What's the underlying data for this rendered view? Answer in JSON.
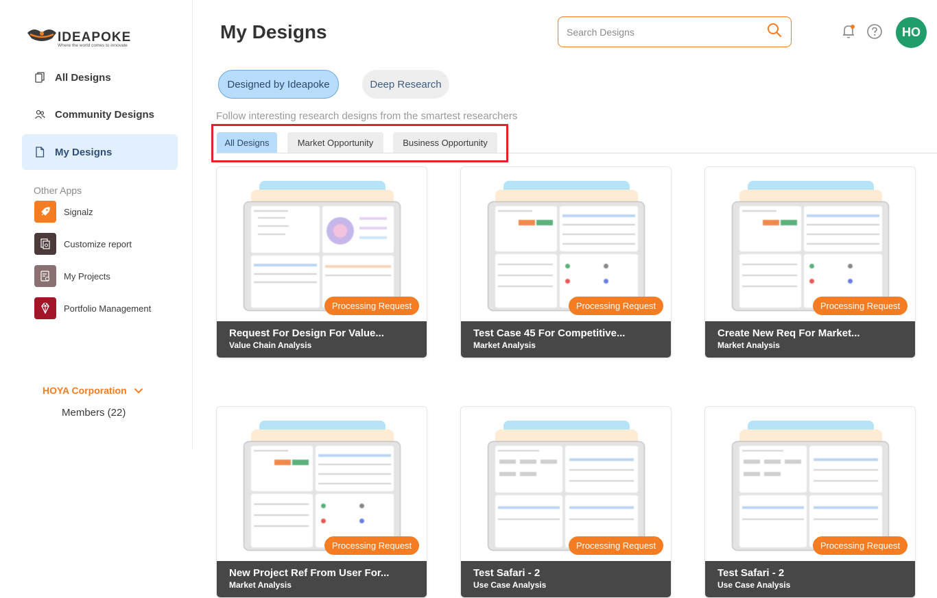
{
  "brand": {
    "name": "IDEAPOKE",
    "tagline": "Where the world comes to innovate"
  },
  "sidebar": {
    "items": [
      {
        "label": "All Designs",
        "icon": "copy-icon",
        "active": false
      },
      {
        "label": "Community Designs",
        "icon": "users-icon",
        "active": false
      },
      {
        "label": "My Designs",
        "icon": "file-icon",
        "active": true
      }
    ],
    "other_apps_title": "Other Apps",
    "apps": [
      {
        "label": "Signalz",
        "icon": "rocket-icon",
        "color": "#f47c22"
      },
      {
        "label": "Customize report",
        "icon": "report-icon",
        "color": "#4a3a3a"
      },
      {
        "label": "My Projects",
        "icon": "projects-icon",
        "color": "#8a7070"
      },
      {
        "label": "Portfolio Management",
        "icon": "gem-icon",
        "color": "#a3162a"
      }
    ],
    "org": {
      "name": "HOYA Corporation",
      "members": "Members (22)"
    }
  },
  "header": {
    "title": "My Designs",
    "search_placeholder": "Search Designs",
    "avatar_initials": "HO"
  },
  "pills": {
    "active": "Designed by Ideapoke",
    "inactive": "Deep Research"
  },
  "subtitle": "Follow interesting research designs from the smartest researchers",
  "tabs": [
    "All Designs",
    "Market Opportunity",
    "Business Opportunity"
  ],
  "badge_label": "Processing Request",
  "cards": [
    {
      "title": "Request For Design For Value...",
      "subtitle": "Value Chain Analysis",
      "thumb": "vca"
    },
    {
      "title": "Test Case 45 For Competitive...",
      "subtitle": "Market Analysis",
      "thumb": "ma"
    },
    {
      "title": "Create New Req For Market...",
      "subtitle": "Market Analysis",
      "thumb": "ma"
    },
    {
      "title": "New Project Ref From User For...",
      "subtitle": "Market Analysis",
      "thumb": "ma"
    },
    {
      "title": "Test Safari - 2",
      "subtitle": "Use Case Analysis",
      "thumb": "uca"
    },
    {
      "title": "Test Safari - 2",
      "subtitle": "Use Case Analysis",
      "thumb": "uca"
    }
  ],
  "colors": {
    "accent": "#f47c22",
    "active_bg": "#e2f0fd",
    "pill_active": "#b8dcfb",
    "highlight_box": "#e1232b",
    "avatar": "#1f9d6b",
    "card_footer": "#474747"
  }
}
